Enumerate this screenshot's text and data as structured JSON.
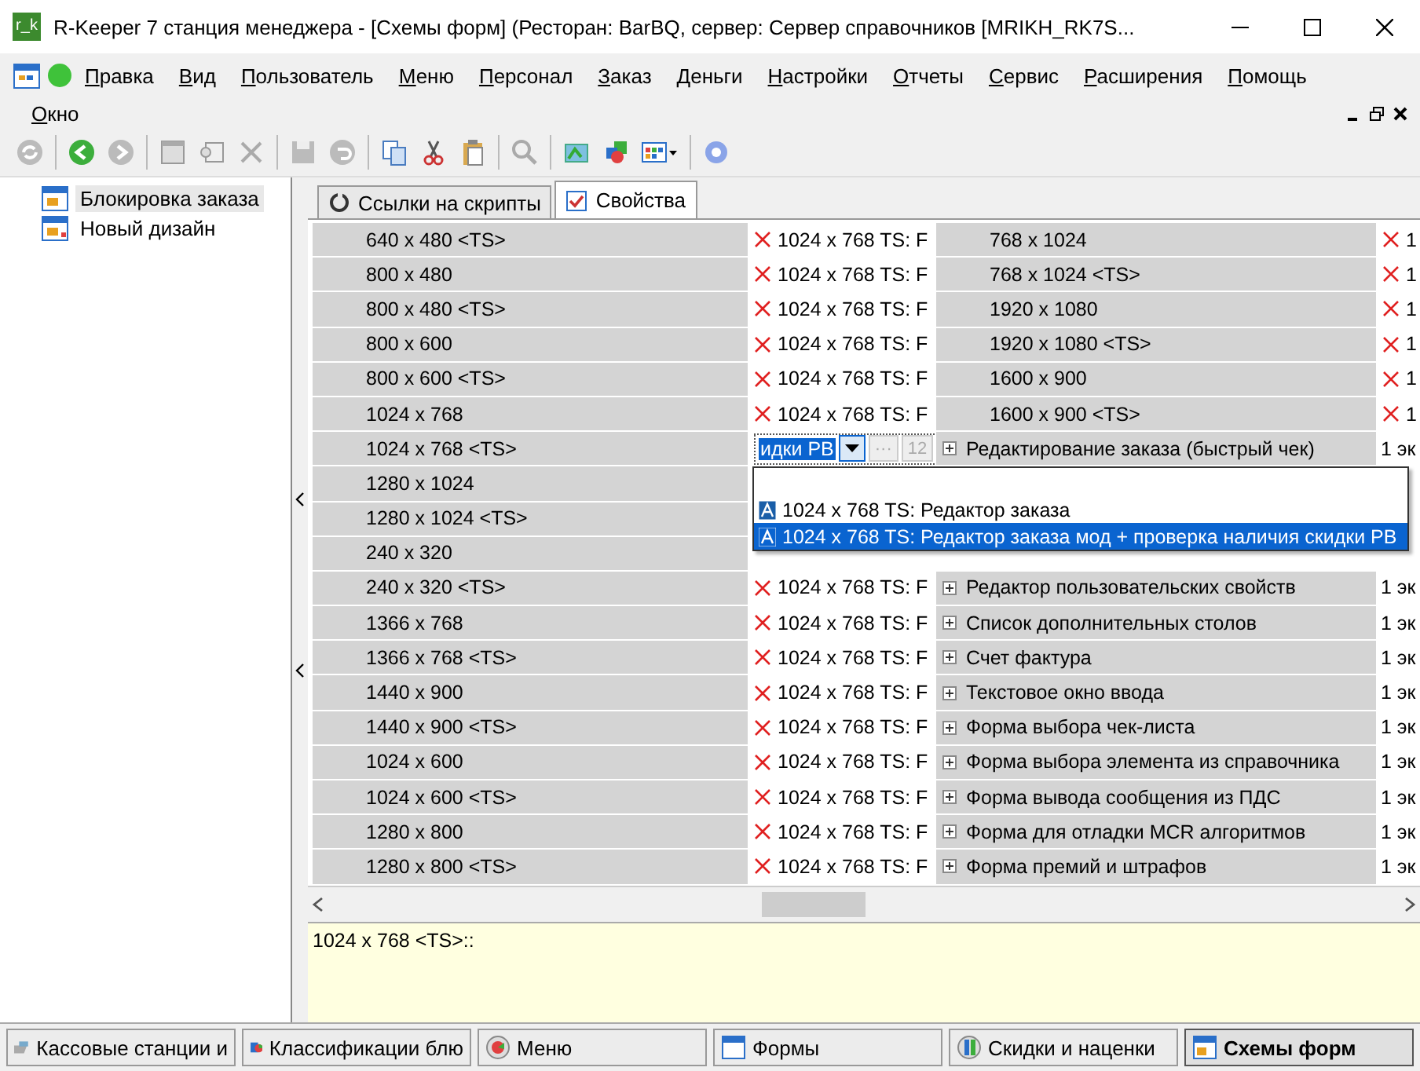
{
  "window": {
    "logo": "r_k",
    "title": "R-Keeper 7 станция менеджера - [Схемы форм] (Ресторан: BarBQ, сервер: Сервер справочников [MRIKH_RK7S..."
  },
  "menu": [
    {
      "label": "Правка"
    },
    {
      "label": "Вид"
    },
    {
      "label": "Пользователь"
    },
    {
      "label": "Меню"
    },
    {
      "label": "Персонал"
    },
    {
      "label": "Заказ"
    },
    {
      "label": "Деньги"
    },
    {
      "label": "Настройки"
    },
    {
      "label": "Отчеты"
    },
    {
      "label": "Сервис"
    },
    {
      "label": "Расширения"
    },
    {
      "label": "Помощь"
    }
  ],
  "menu_row2": [
    {
      "label": "Окно"
    }
  ],
  "tree": [
    {
      "label": "Блокировка заказа",
      "selected": true
    },
    {
      "label": "Новый дизайн",
      "selected": false
    }
  ],
  "tabs": [
    {
      "label": "Ссылки на скрипты",
      "selected": false
    },
    {
      "label": "Свойства",
      "selected": true
    }
  ],
  "grid": {
    "rows": [
      {
        "left": {
          "kind": "size",
          "name": "640 x 480 <TS>",
          "value": {
            "text": "1024 x 768 TS: F",
            "error": true
          }
        },
        "right": {
          "kind": "size",
          "name": "768 x 1024",
          "value": {
            "text": "1",
            "error": true
          }
        }
      },
      {
        "left": {
          "kind": "size",
          "name": "800 x 480",
          "value": {
            "text": "1024 x 768 TS: F",
            "error": true
          }
        },
        "right": {
          "kind": "size",
          "name": "768 x 1024 <TS>",
          "value": {
            "text": "1",
            "error": true
          }
        }
      },
      {
        "left": {
          "kind": "size",
          "name": "800 x 480 <TS>",
          "value": {
            "text": "1024 x 768 TS: F",
            "error": true
          }
        },
        "right": {
          "kind": "size",
          "name": "1920 x 1080",
          "value": {
            "text": "1",
            "error": true
          }
        }
      },
      {
        "left": {
          "kind": "size",
          "name": "800 x 600",
          "value": {
            "text": "1024 x 768 TS: F",
            "error": true
          }
        },
        "right": {
          "kind": "size",
          "name": "1920 x 1080 <TS>",
          "value": {
            "text": "1",
            "error": true
          }
        }
      },
      {
        "left": {
          "kind": "size",
          "name": "800 x 600 <TS>",
          "value": {
            "text": "1024 x 768 TS: F",
            "error": true
          }
        },
        "right": {
          "kind": "size",
          "name": "1600 x 900",
          "value": {
            "text": "1",
            "error": true
          }
        }
      },
      {
        "left": {
          "kind": "size",
          "name": "1024 x 768",
          "value": {
            "text": "1024 x 768 TS: F",
            "error": true
          }
        },
        "right": {
          "kind": "size",
          "name": "1600 x 900 <TS>",
          "value": {
            "text": "1",
            "error": true
          }
        }
      },
      {
        "left": {
          "kind": "size",
          "name": "1024 x 768 <TS>",
          "editor": {
            "text": "идки РВ",
            "buttons": [
              "···",
              "12"
            ]
          }
        },
        "right": {
          "kind": "group",
          "name": "Редактирование заказа (быстрый чек)",
          "value": {
            "text": "1 эк",
            "error": false
          }
        }
      },
      {
        "left": {
          "kind": "size",
          "name": "1280 x 1024"
        }
      },
      {
        "left": {
          "kind": "size",
          "name": "1280 x 1024 <TS>"
        }
      },
      {
        "left": {
          "kind": "size",
          "name": "240 x 320"
        }
      },
      {
        "left": {
          "kind": "size",
          "name": "240 x 320 <TS>",
          "value": {
            "text": "1024 x 768 TS: F",
            "error": true
          }
        },
        "right": {
          "kind": "group",
          "name": "Редактор пользовательских свойств",
          "value": {
            "text": "1 эк",
            "error": false
          }
        }
      },
      {
        "left": {
          "kind": "size",
          "name": "1366 x 768",
          "value": {
            "text": "1024 x 768 TS: F",
            "error": true
          }
        },
        "right": {
          "kind": "group",
          "name": "Список дополнительных столов",
          "value": {
            "text": "1 эк",
            "error": false
          }
        }
      },
      {
        "left": {
          "kind": "size",
          "name": "1366 x 768 <TS>",
          "value": {
            "text": "1024 x 768 TS: F",
            "error": true
          }
        },
        "right": {
          "kind": "group",
          "name": "Счет фактура",
          "value": {
            "text": "1 эк",
            "error": false
          }
        }
      },
      {
        "left": {
          "kind": "size",
          "name": "1440 x 900",
          "value": {
            "text": "1024 x 768 TS: F",
            "error": true
          }
        },
        "right": {
          "kind": "group",
          "name": "Текстовое окно ввода",
          "value": {
            "text": "1 эк",
            "error": false
          }
        }
      },
      {
        "left": {
          "kind": "size",
          "name": "1440 x 900 <TS>",
          "value": {
            "text": "1024 x 768 TS: F",
            "error": true
          }
        },
        "right": {
          "kind": "group",
          "name": "Форма выбора чек-листа",
          "value": {
            "text": "1 эк",
            "error": false
          }
        }
      },
      {
        "left": {
          "kind": "size",
          "name": "1024 x 600",
          "value": {
            "text": "1024 x 768 TS: F",
            "error": true
          }
        },
        "right": {
          "kind": "group",
          "name": "Форма выбора элемента из справочника",
          "value": {
            "text": "1 эк",
            "error": false
          }
        }
      },
      {
        "left": {
          "kind": "size",
          "name": "1024 x 600 <TS>",
          "value": {
            "text": "1024 x 768 TS: F",
            "error": true
          }
        },
        "right": {
          "kind": "group",
          "name": "Форма вывода сообщения из ПДС",
          "value": {
            "text": "1 эк",
            "error": false
          }
        }
      },
      {
        "left": {
          "kind": "size",
          "name": "1280 x 800",
          "value": {
            "text": "1024 x 768 TS: F",
            "error": true
          }
        },
        "right": {
          "kind": "group",
          "name": "Форма для отладки MCR алгоритмов",
          "value": {
            "text": "1 эк",
            "error": false
          }
        }
      },
      {
        "left": {
          "kind": "size",
          "name": "1280 x 800 <TS>",
          "value": {
            "text": "1024 x 768 TS: F",
            "error": true
          }
        },
        "right": {
          "kind": "group",
          "name": "Форма премий и штрафов",
          "value": {
            "text": "1 эк",
            "error": false
          }
        }
      }
    ]
  },
  "dropdown": {
    "items": [
      {
        "text": "1024 x 768 TS: Редактор заказа",
        "selected": false
      },
      {
        "text": "1024 x 768 TS: Редактор заказа мод + проверка наличия скидки РВ",
        "selected": true
      }
    ]
  },
  "memo": {
    "text": "1024 x 768 <TS>::"
  },
  "taskbar": [
    {
      "label": "Кассовые станции и",
      "selected": false
    },
    {
      "label": "Классификации блю",
      "selected": false
    },
    {
      "label": "Меню",
      "selected": false
    },
    {
      "label": "Формы",
      "selected": false
    },
    {
      "label": "Скидки и наценки",
      "selected": false
    },
    {
      "label": "Схемы форм",
      "selected": true
    }
  ]
}
